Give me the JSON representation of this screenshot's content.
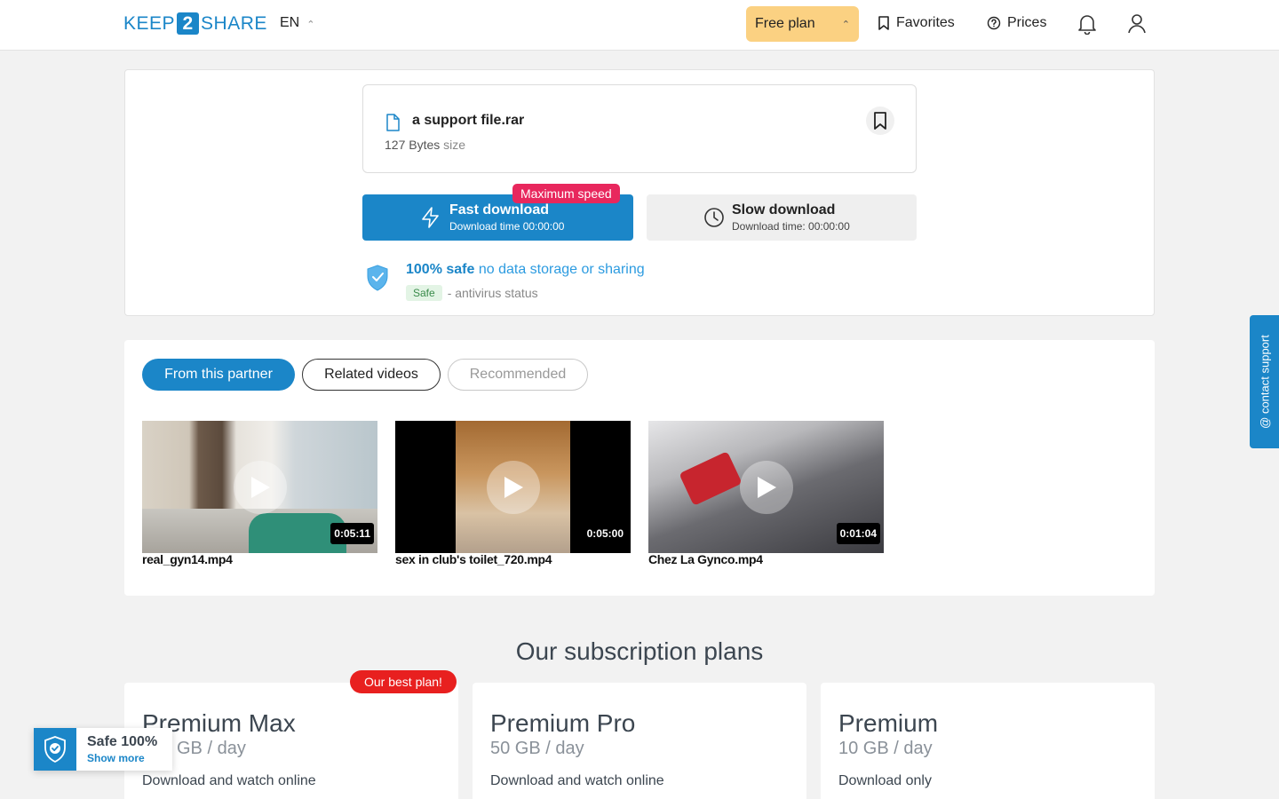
{
  "header": {
    "logo_left": "KEEP",
    "logo_mid": "2",
    "logo_right": "SHARE",
    "language": "EN",
    "plan_label": "Free plan",
    "favorites_label": "Favorites",
    "prices_label": "Prices"
  },
  "file": {
    "name": "a support file.rar",
    "size_value": "127 Bytes",
    "size_unit": "size"
  },
  "downloads": {
    "fast_title": "Fast download",
    "fast_sub": "Download time 00:00:00",
    "max_badge": "Maximum speed",
    "slow_title": "Slow download",
    "slow_sub": "Download time: 00:00:00"
  },
  "safety": {
    "safe_bold": "100% safe",
    "safe_rest": "no data storage or sharing",
    "chip": "Safe",
    "antivirus": "- antivirus status"
  },
  "tabs": [
    {
      "label": "From this partner"
    },
    {
      "label": "Related videos"
    },
    {
      "label": "Recommended"
    }
  ],
  "videos": [
    {
      "title": "real_gyn14.mp4",
      "duration": "0:05:11"
    },
    {
      "title": "sex in club's toilet_720.mp4",
      "duration": "0:05:00"
    },
    {
      "title": "Chez La Gynco.mp4",
      "duration": "0:01:04"
    }
  ],
  "plans": {
    "title": "Our subscription plans",
    "best_badge": "Our best plan!",
    "items": [
      {
        "name": "Premium Max",
        "quota": "GB / day",
        "desc": "Download and watch online"
      },
      {
        "name": "Premium Pro",
        "quota": "50 GB / day",
        "desc": "Download and watch online"
      },
      {
        "name": "Premium",
        "quota": "10 GB / day",
        "desc": "Download only"
      }
    ]
  },
  "contact_support": "@ contact support",
  "safe_widget": {
    "title": "Safe 100%",
    "link": "Show more"
  },
  "colors": {
    "accent": "#1b86c8",
    "plan_button": "#fbd182",
    "badge_pink": "#e8275d",
    "badge_red": "#e8201f"
  }
}
